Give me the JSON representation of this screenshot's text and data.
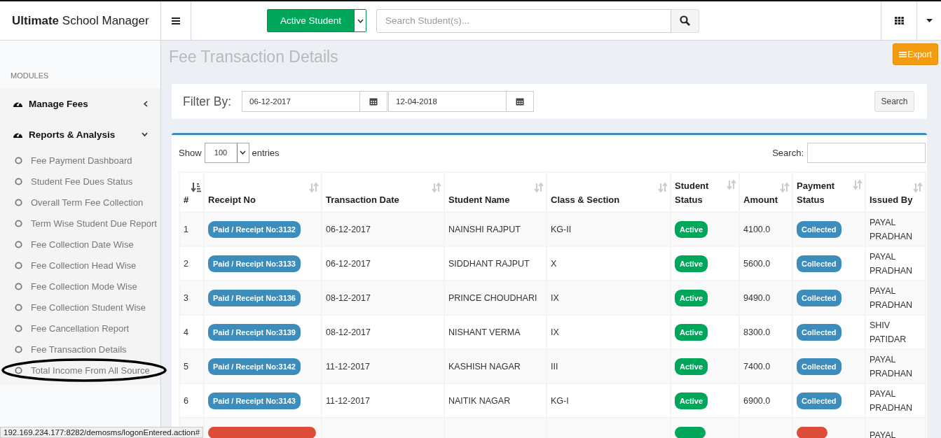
{
  "brand": "**Ultimate** School Manager",
  "header": {
    "student_filter": "Active Student",
    "search": {
      "placeholder": "Search Student(s)..."
    }
  },
  "sidebar": {
    "section": "MODULES",
    "groups": [
      {
        "label": "Manage Fees",
        "expanded": false
      },
      {
        "label": "Reports & Analysis",
        "expanded": true,
        "children": [
          {
            "label": "Fee Payment Dashboard"
          },
          {
            "label": "Student Fee Dues Status"
          },
          {
            "label": "Overall Term Fee Collection"
          },
          {
            "label": "Term Wise Student Due Report"
          },
          {
            "label": "Fee Collection Date Wise"
          },
          {
            "label": "Fee Collection Head Wise"
          },
          {
            "label": "Fee Collection Mode Wise"
          },
          {
            "label": "Fee Collection Student Wise"
          },
          {
            "label": "Fee Cancellation Report"
          },
          {
            "label": "Fee Transaction Details"
          },
          {
            "label": "Total Income From All Source",
            "circled": true
          }
        ]
      }
    ]
  },
  "page": {
    "title": "Fee Transaction Details",
    "export_button": "Export"
  },
  "filter": {
    "label": "Filter By:",
    "from": "06-12-2017",
    "to": "12-04-2018",
    "search_button": "Search"
  },
  "table_controls": {
    "show": "Show",
    "page_size": "100",
    "entries": "entries",
    "search_label": "Search:"
  },
  "table": {
    "columns": [
      {
        "label": "#",
        "kind": "sorted"
      },
      {
        "label": "Receipt No",
        "kind": "sortable"
      },
      {
        "label": "Transaction Date",
        "kind": "sortable"
      },
      {
        "label": "Student Name",
        "kind": "sortable"
      },
      {
        "label": "Class & Section",
        "kind": "sortable"
      },
      {
        "label": "Student Status",
        "kind": "sortable"
      },
      {
        "label": "Amount",
        "kind": "sortable"
      },
      {
        "label": "Payment Status",
        "kind": "sortable"
      },
      {
        "label": "Issued By",
        "kind": "sortable"
      }
    ],
    "rows": [
      {
        "no": "1",
        "receipt": {
          "text": "Paid / Receipt No:3132",
          "kind": "paid"
        },
        "date": "06-12-2017",
        "name": "NAINSHI RAJPUT",
        "class": "KG-II",
        "student_status": {
          "text": "Active",
          "kind": "active"
        },
        "amount": "4100.0",
        "payment_status": {
          "text": "Collected",
          "kind": "collected"
        },
        "issued_by": "PAYAL PRADHAN"
      },
      {
        "no": "2",
        "receipt": {
          "text": "Paid / Receipt No:3133",
          "kind": "paid"
        },
        "date": "06-12-2017",
        "name": "SIDDHANT RAJPUT",
        "class": "X",
        "student_status": {
          "text": "Active",
          "kind": "active"
        },
        "amount": "5600.0",
        "payment_status": {
          "text": "Collected",
          "kind": "collected"
        },
        "issued_by": "PAYAL PRADHAN"
      },
      {
        "no": "3",
        "receipt": {
          "text": "Paid / Receipt No:3136",
          "kind": "paid"
        },
        "date": "08-12-2017",
        "name": "PRINCE CHOUDHARI",
        "class": "IX",
        "student_status": {
          "text": "Active",
          "kind": "active"
        },
        "amount": "9490.0",
        "payment_status": {
          "text": "Collected",
          "kind": "collected"
        },
        "issued_by": "PAYAL PRADHAN"
      },
      {
        "no": "4",
        "receipt": {
          "text": "Paid / Receipt No:3139",
          "kind": "paid"
        },
        "date": "08-12-2017",
        "name": "NISHANT VERMA",
        "class": "IX",
        "student_status": {
          "text": "Active",
          "kind": "active"
        },
        "amount": "8300.0",
        "payment_status": {
          "text": "Collected",
          "kind": "collected"
        },
        "issued_by": "SHIV PATIDAR"
      },
      {
        "no": "5",
        "receipt": {
          "text": "Paid / Receipt No:3142",
          "kind": "paid"
        },
        "date": "11-12-2017",
        "name": "KASHISH NAGAR",
        "class": "III",
        "student_status": {
          "text": "Active",
          "kind": "active"
        },
        "amount": "7400.0",
        "payment_status": {
          "text": "Collected",
          "kind": "collected"
        },
        "issued_by": "PAYAL PRADHAN"
      },
      {
        "no": "6",
        "receipt": {
          "text": "Paid / Receipt No:3143",
          "kind": "paid"
        },
        "date": "11-12-2017",
        "name": "NAITIK NAGAR",
        "class": "KG-I",
        "student_status": {
          "text": "Active",
          "kind": "active"
        },
        "amount": "6900.0",
        "payment_status": {
          "text": "Collected",
          "kind": "collected"
        },
        "issued_by": "PAYAL PRADHAN"
      },
      {
        "receipt": {
          "kind": "cancelled"
        },
        "student_status": {
          "kind": "active"
        },
        "payment_status": {
          "kind": "cancelled"
        },
        "issued_by": "PAYAL"
      }
    ]
  },
  "status_url": "192.169.234.177:8282/demosms/logonEntered.action#"
}
